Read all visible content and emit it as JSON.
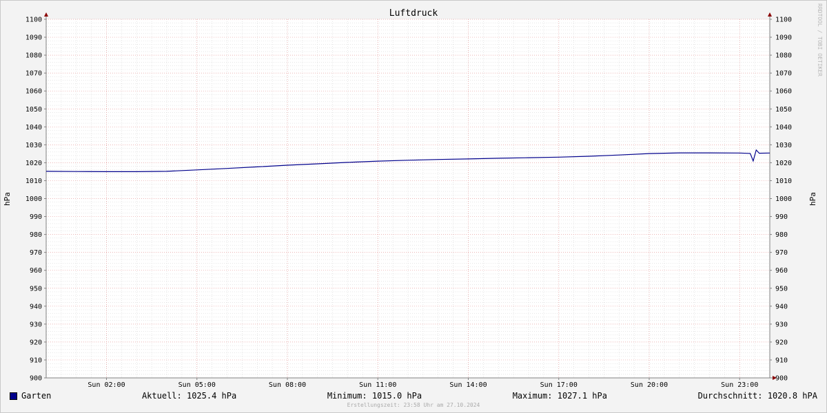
{
  "chart_data": {
    "type": "line",
    "title": "Luftdruck",
    "ylabel": "hPa",
    "ylabel_right": "hPa",
    "ylim": [
      900,
      1100
    ],
    "xlim": [
      0,
      24
    ],
    "y_ticks": [
      900,
      910,
      920,
      930,
      940,
      950,
      960,
      970,
      980,
      990,
      1000,
      1010,
      1020,
      1030,
      1040,
      1050,
      1060,
      1070,
      1080,
      1090,
      1100
    ],
    "x_ticks": [
      {
        "value": 2,
        "label": "Sun 02:00"
      },
      {
        "value": 5,
        "label": "Sun 05:00"
      },
      {
        "value": 8,
        "label": "Sun 08:00"
      },
      {
        "value": 11,
        "label": "Sun 11:00"
      },
      {
        "value": 14,
        "label": "Sun 14:00"
      },
      {
        "value": 17,
        "label": "Sun 17:00"
      },
      {
        "value": 20,
        "label": "Sun 20:00"
      },
      {
        "value": 23,
        "label": "Sun 23:00"
      }
    ],
    "grid": true,
    "series": [
      {
        "name": "Garten",
        "color": "#00008b",
        "x": [
          0,
          1,
          2,
          3,
          4,
          5,
          6,
          7,
          8,
          9,
          10,
          11,
          12,
          13,
          14,
          15,
          16,
          17,
          18,
          19,
          20,
          21,
          22,
          23,
          23.35,
          23.45,
          23.55,
          23.65,
          24
        ],
        "y": [
          1015.2,
          1015.1,
          1015.0,
          1015.0,
          1015.2,
          1016.0,
          1016.8,
          1017.7,
          1018.6,
          1019.4,
          1020.2,
          1020.9,
          1021.4,
          1021.8,
          1022.1,
          1022.5,
          1022.8,
          1023.1,
          1023.6,
          1024.3,
          1025.1,
          1025.5,
          1025.5,
          1025.4,
          1025.2,
          1021.0,
          1027.1,
          1025.3,
          1025.4
        ]
      }
    ]
  },
  "legend": {
    "series_name": "Garten",
    "swatch_color": "#00008b",
    "current": "Aktuell: 1025.4 hPa",
    "minimum": "Minimum: 1015.0 hPa",
    "maximum": "Maximum: 1027.1 hPa",
    "average": "Durchschnitt: 1020.8 hPA"
  },
  "watermark": "RRDTOOL / TOBI OETIKER",
  "footer": "Erstellungszeit: 23:58 Uhr am 27.10.2024"
}
